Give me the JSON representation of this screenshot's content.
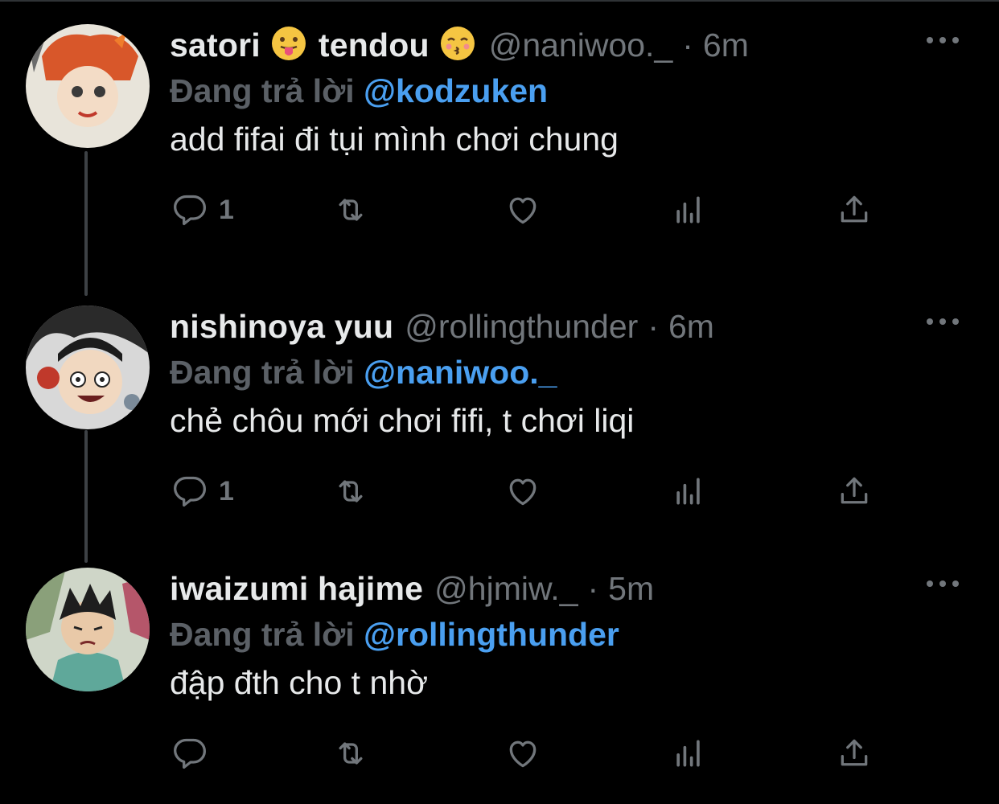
{
  "colors": {
    "background": "#000000",
    "text": "#e7e9ea",
    "muted": "#71767b",
    "mention": "#4a9ff0"
  },
  "tweets": [
    {
      "name": "satori",
      "name2": "tendou",
      "emoji1": "tongue-face",
      "emoji2": "kissing-face",
      "handle": "@naniwoo._",
      "separator": "·",
      "time": "6m",
      "replying_to_label": "Đang trả lời",
      "replying_to": "@kodzuken",
      "text": "add fifai đi tụi mình chơi chung",
      "reply_count": "1"
    },
    {
      "name": "nishinoya yuu",
      "handle": "@rollingthunder",
      "separator": "·",
      "time": "6m",
      "replying_to_label": "Đang trả lời",
      "replying_to": "@naniwoo._",
      "text": "chẻ chôu mới chơi fifi, t chơi liqi",
      "reply_count": "1"
    },
    {
      "name": "iwaizumi hajime",
      "handle": "@hjmiw._",
      "separator": "·",
      "time": "5m",
      "replying_to_label": "Đang trả lời",
      "replying_to": "@rollingthunder",
      "text": "đập đth cho t nhờ",
      "reply_count": ""
    }
  ],
  "icons": [
    "reply-icon",
    "retweet-icon",
    "like-icon",
    "analytics-icon",
    "share-icon",
    "more-icon"
  ]
}
